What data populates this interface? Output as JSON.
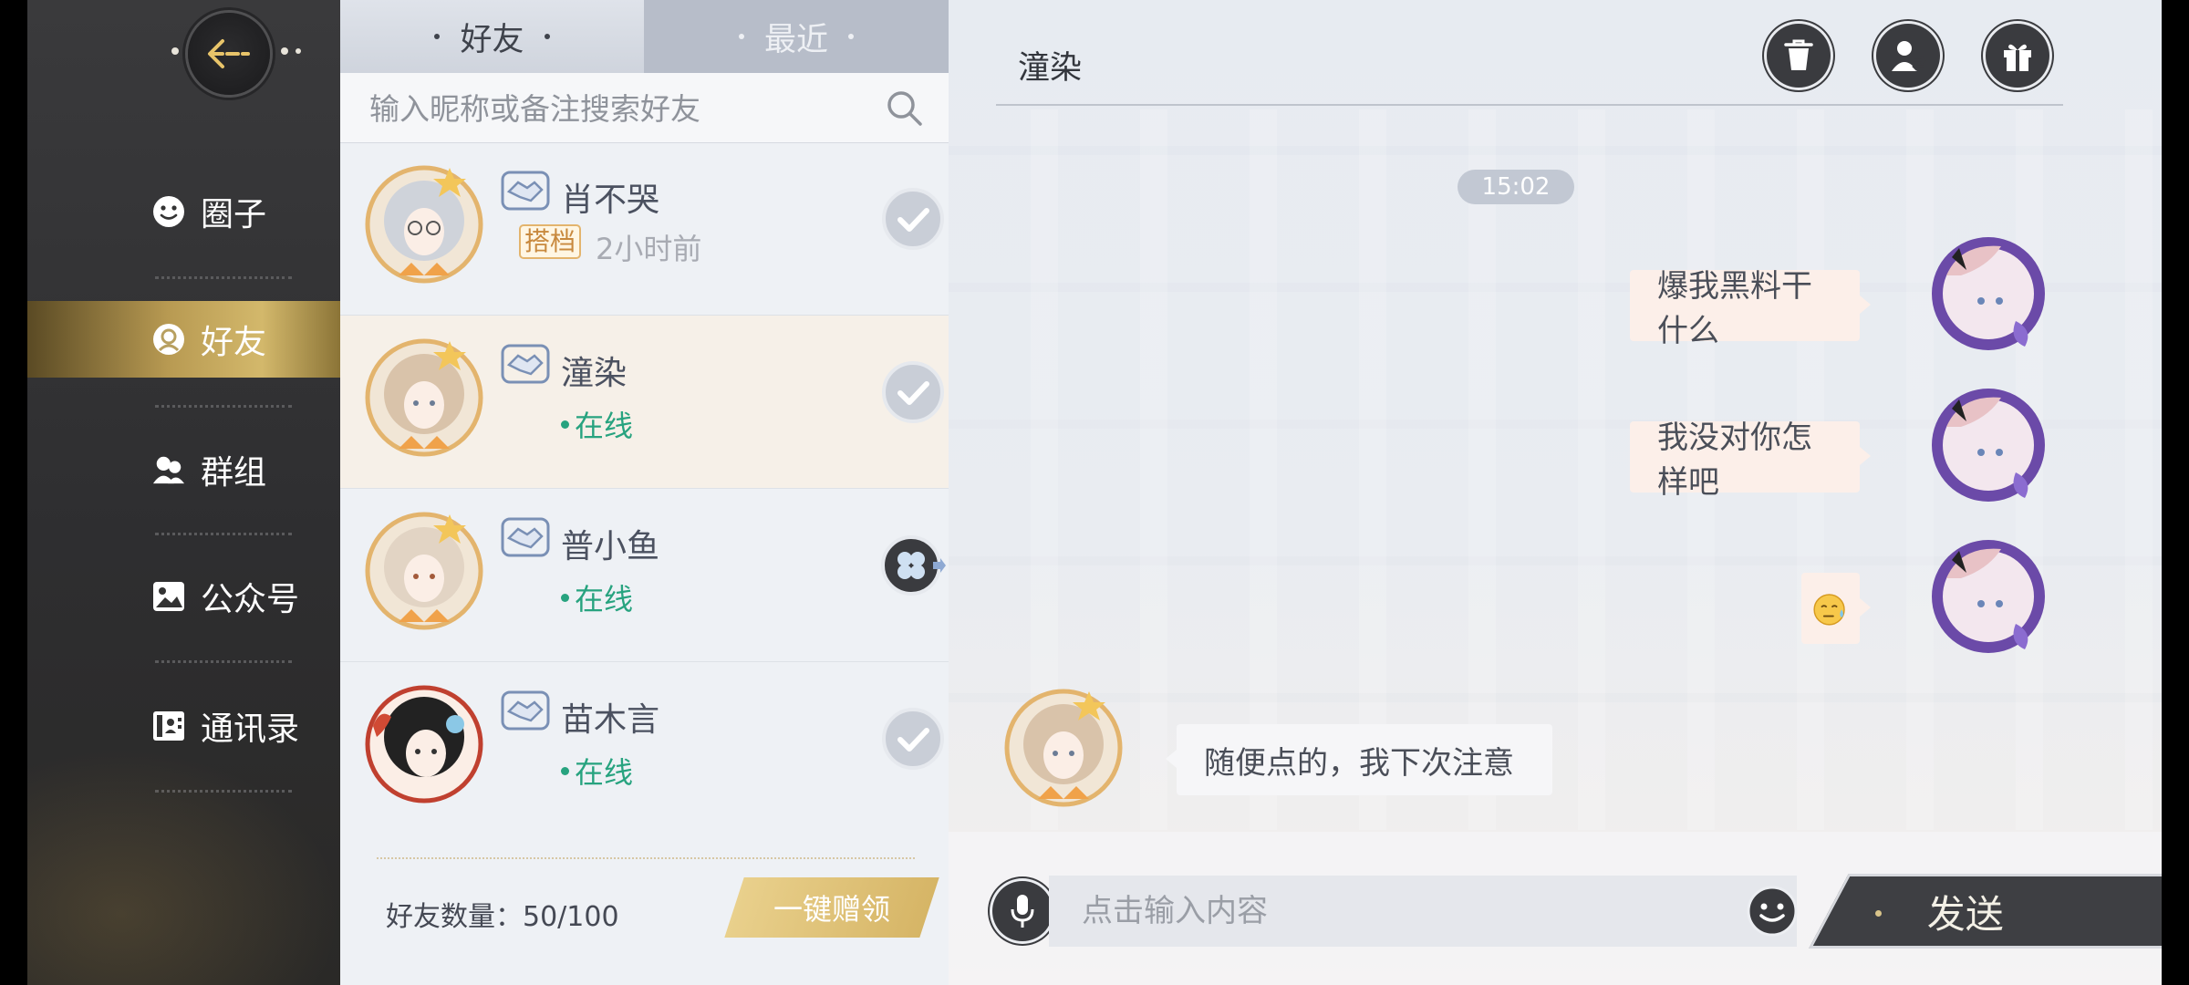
{
  "nav": {
    "items": [
      {
        "label": "圈子",
        "icon": "smiley-icon"
      },
      {
        "label": "好友",
        "icon": "friend-face-icon"
      },
      {
        "label": "群组",
        "icon": "group-icon"
      },
      {
        "label": "公众号",
        "icon": "image-icon"
      },
      {
        "label": "通讯录",
        "icon": "contacts-icon"
      }
    ],
    "active_index": 1
  },
  "friends_panel": {
    "tabs": [
      {
        "label": "好友",
        "active": true
      },
      {
        "label": "最近",
        "active": false
      }
    ],
    "search_placeholder": "输入昵称或备注搜索好友",
    "friends": [
      {
        "name": "肖不哭",
        "tag": "搭档",
        "status": "2小时前",
        "online": false,
        "gift_state": "claimed"
      },
      {
        "name": "潼染",
        "status": "在线",
        "online": true,
        "gift_state": "claimed",
        "selected": true
      },
      {
        "name": "普小鱼",
        "status": "在线",
        "online": true,
        "gift_state": "send"
      },
      {
        "name": "苗木言",
        "status": "在线",
        "online": true,
        "gift_state": "claimed"
      }
    ],
    "friend_count_label": "好友数量：50/100",
    "claim_all_label": "一键赠领"
  },
  "chat": {
    "title": "潼染",
    "header_buttons": [
      "trash-icon",
      "switch-user-icon",
      "gift-icon"
    ],
    "timestamp": "15:02",
    "messages": [
      {
        "direction": "out",
        "text": "爆我黑料干什么"
      },
      {
        "direction": "out",
        "text": "我没对你怎样吧"
      },
      {
        "direction": "out",
        "text": "",
        "emoji": "sweat-emoji"
      },
      {
        "direction": "in",
        "text": "随便点的，我下次注意"
      }
    ],
    "input_placeholder": "点击输入内容",
    "send_label": "发送"
  },
  "colors": {
    "accent_gold": "#d3b86b",
    "online_green": "#27a37f",
    "dark_button": "#3a3b3f"
  }
}
